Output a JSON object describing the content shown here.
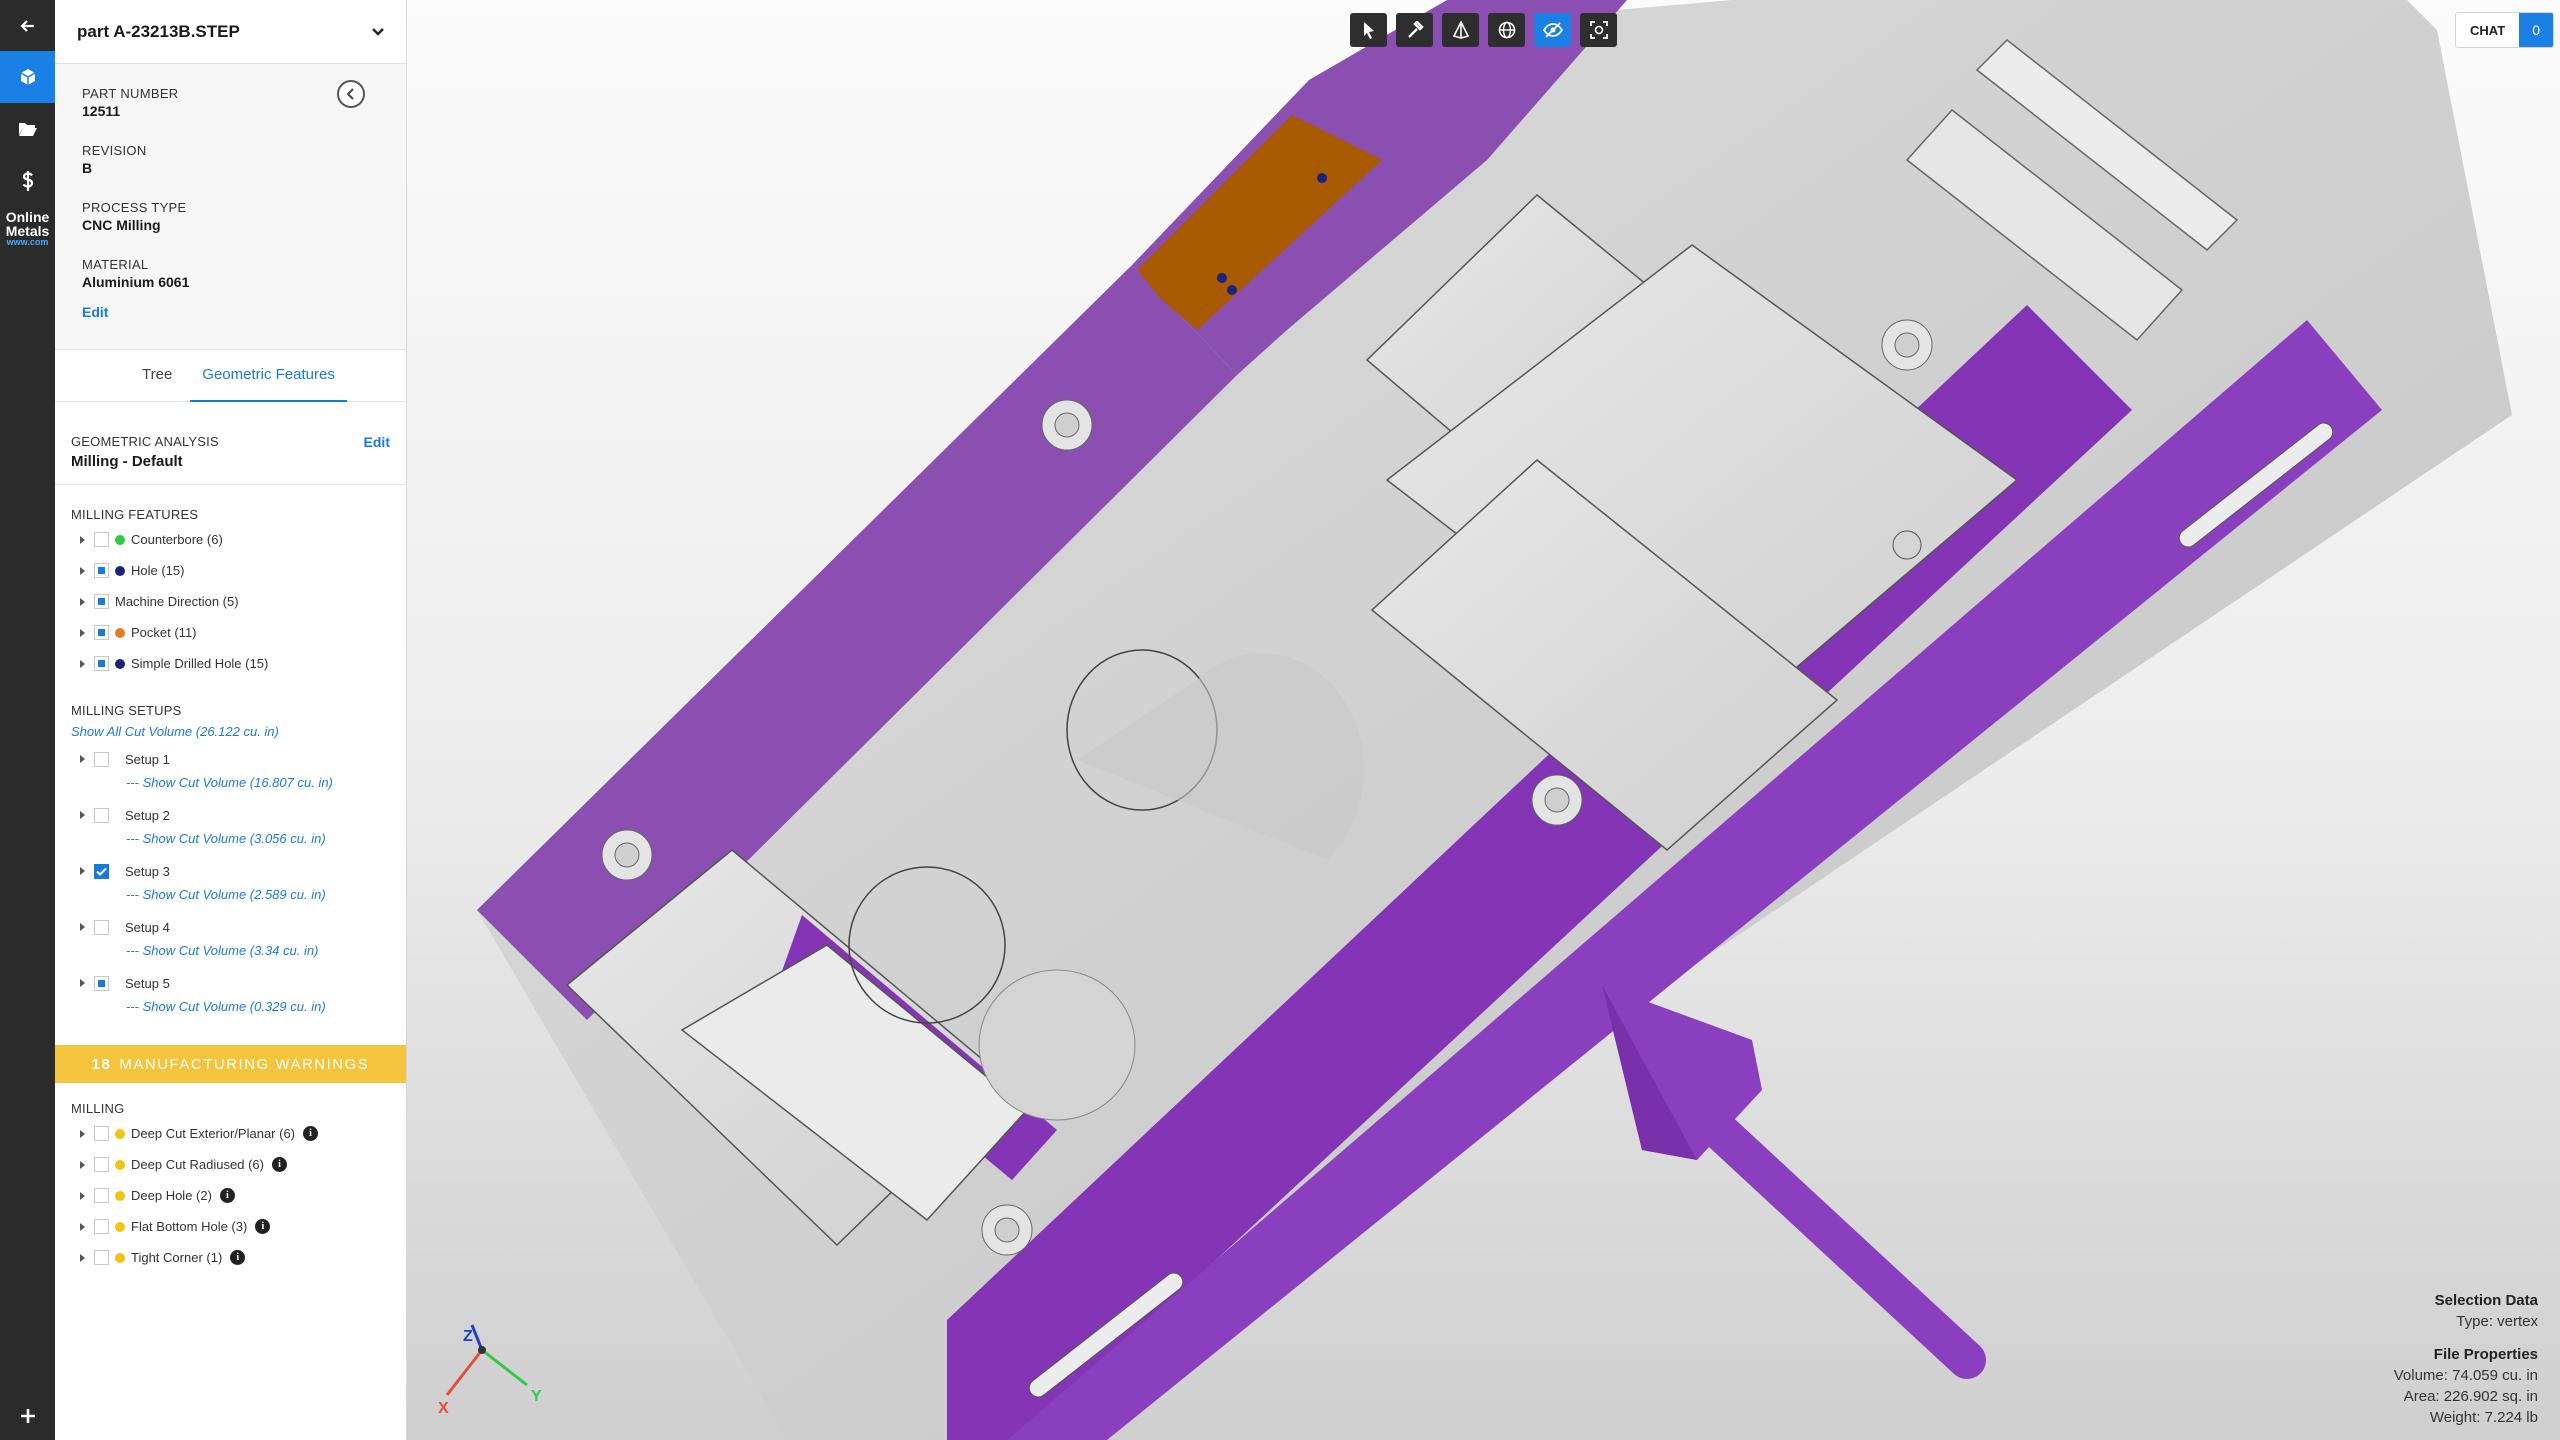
{
  "file": {
    "title": "part A-23213B.STEP"
  },
  "properties": [
    {
      "label": "PART NUMBER",
      "value": "12511"
    },
    {
      "label": "REVISION",
      "value": "B"
    },
    {
      "label": "PROCESS TYPE",
      "value": "CNC Milling"
    },
    {
      "label": "MATERIAL",
      "value": "Aluminium 6061"
    }
  ],
  "edit_label": "Edit",
  "rail": {
    "logo_line1": "Online",
    "logo_line2": "Metals",
    "logo_line3": "www.com"
  },
  "tabs": [
    {
      "label": "Tree"
    },
    {
      "label": "Geometric Features"
    }
  ],
  "geometric_analysis": {
    "heading": "GEOMETRIC ANALYSIS",
    "value": "Milling - Default",
    "edit": "Edit"
  },
  "milling_features": {
    "heading": "MILLING FEATURES",
    "items": [
      {
        "label": "Counterbore (6)",
        "color": "#2ecc40"
      },
      {
        "label": "Hole (15)",
        "color": "#1a237e"
      },
      {
        "label": "Machine Direction (5)"
      },
      {
        "label": "Pocket (11)",
        "color": "#e67e22"
      },
      {
        "label": "Simple Drilled Hole (15)",
        "color": "#1a237e"
      }
    ]
  },
  "milling_setups": {
    "heading": "MILLING SETUPS",
    "show_all": "Show All Cut Volume (26.122 cu. in)",
    "items": [
      {
        "label": "Setup 1",
        "cut": "--- Show Cut Volume (16.807 cu. in)"
      },
      {
        "label": "Setup 2",
        "cut": "--- Show Cut Volume (3.056 cu. in)"
      },
      {
        "label": "Setup 3",
        "cut": "--- Show Cut Volume (2.589 cu. in)"
      },
      {
        "label": "Setup 4",
        "cut": "--- Show Cut Volume (3.34 cu. in)"
      },
      {
        "label": "Setup 5",
        "cut": "--- Show Cut Volume (0.329 cu. in)"
      }
    ]
  },
  "warnings": {
    "count": "18",
    "banner": "MANUFACTURING WARNINGS",
    "heading": "MILLING",
    "items": [
      {
        "label": "Deep Cut Exterior/Planar (6)"
      },
      {
        "label": "Deep Cut Radiused (6)"
      },
      {
        "label": "Deep Hole (2)"
      },
      {
        "label": "Flat Bottom Hole (3)"
      },
      {
        "label": "Tight Corner (1)"
      }
    ],
    "info_glyph": "i"
  },
  "chat": {
    "label": "CHAT",
    "count": "0"
  },
  "selection": {
    "heading": "Selection Data",
    "type": "Type: vertex"
  },
  "file_properties": {
    "heading": "File Properties",
    "volume": "Volume: 74.059 cu. in",
    "area": "Area: 226.902 sq. in",
    "weight": "Weight: 7.224 lb"
  },
  "axes": {
    "x": "X",
    "y": "Y",
    "z": "Z"
  },
  "colors": {
    "accent": "#1a80e6",
    "purple": "#8a3fbf",
    "orange": "#a85a00",
    "warning": "#f4c53c"
  }
}
